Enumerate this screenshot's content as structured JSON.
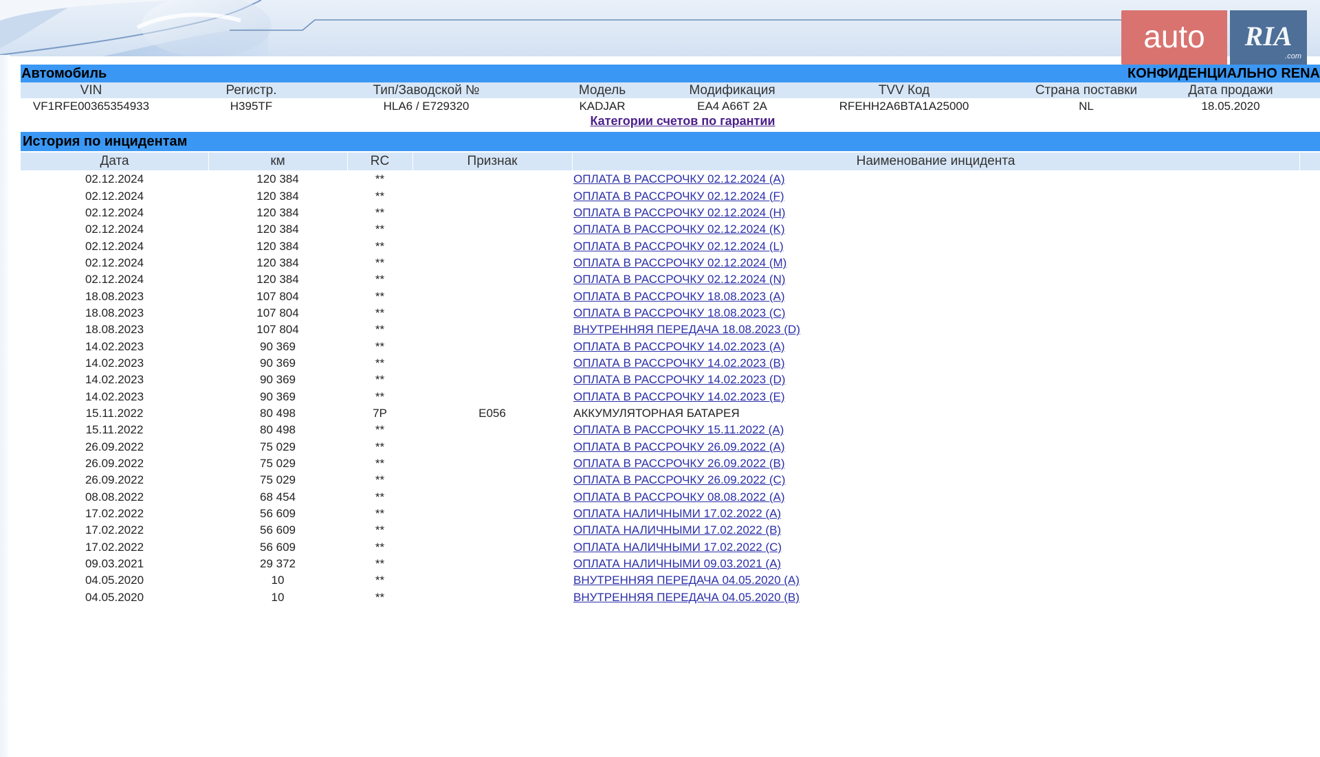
{
  "branding": {
    "logo_auto": "auto",
    "logo_ria": "RIA",
    "logo_com": ".com"
  },
  "vehicle": {
    "section_title": "Автомобиль",
    "confidential": "КОНФИДЕНЦИАЛЬНО RENA",
    "headers": [
      "VIN",
      "Регистр.",
      "Тип/Заводской №",
      "Модель",
      "Модификация",
      "TVV Код",
      "Страна поставки",
      "Дата продажи"
    ],
    "values": [
      "VF1RFE00365354933",
      "H395TF",
      "HLA6 / E729320",
      "KADJAR",
      "EA4 A66T 2A",
      "RFEHH2A6BTA1A25000",
      "NL",
      "18.05.2020"
    ],
    "warranty_link": "Категории счетов по гарантии"
  },
  "incidents": {
    "section_title": "История по инцидентам",
    "headers": [
      "Дата",
      "км",
      "RC",
      "Признак",
      "Наименование инцидента"
    ],
    "rows": [
      {
        "date": "02.12.2024",
        "km": "120 384",
        "rc": "**",
        "sign": "",
        "name": "ОПЛАТА В РАССРОЧКУ 02.12.2024 (A)",
        "link": true
      },
      {
        "date": "02.12.2024",
        "km": "120 384",
        "rc": "**",
        "sign": "",
        "name": "ОПЛАТА В РАССРОЧКУ 02.12.2024 (F)",
        "link": true
      },
      {
        "date": "02.12.2024",
        "km": "120 384",
        "rc": "**",
        "sign": "",
        "name": "ОПЛАТА В РАССРОЧКУ 02.12.2024 (H)",
        "link": true
      },
      {
        "date": "02.12.2024",
        "km": "120 384",
        "rc": "**",
        "sign": "",
        "name": "ОПЛАТА В РАССРОЧКУ 02.12.2024 (K)",
        "link": true
      },
      {
        "date": "02.12.2024",
        "km": "120 384",
        "rc": "**",
        "sign": "",
        "name": "ОПЛАТА В РАССРОЧКУ 02.12.2024 (L)",
        "link": true
      },
      {
        "date": "02.12.2024",
        "km": "120 384",
        "rc": "**",
        "sign": "",
        "name": "ОПЛАТА В РАССРОЧКУ 02.12.2024 (M)",
        "link": true
      },
      {
        "date": "02.12.2024",
        "km": "120 384",
        "rc": "**",
        "sign": "",
        "name": "ОПЛАТА В РАССРОЧКУ 02.12.2024 (N)",
        "link": true
      },
      {
        "date": "18.08.2023",
        "km": "107 804",
        "rc": "**",
        "sign": "",
        "name": "ОПЛАТА В РАССРОЧКУ 18.08.2023 (A)",
        "link": true
      },
      {
        "date": "18.08.2023",
        "km": "107 804",
        "rc": "**",
        "sign": "",
        "name": "ОПЛАТА В РАССРОЧКУ 18.08.2023 (C)",
        "link": true
      },
      {
        "date": "18.08.2023",
        "km": "107 804",
        "rc": "**",
        "sign": "",
        "name": "ВНУТРЕННЯЯ ПЕРЕДАЧА 18.08.2023 (D)",
        "link": true
      },
      {
        "date": "14.02.2023",
        "km": "90 369",
        "rc": "**",
        "sign": "",
        "name": "ОПЛАТА В РАССРОЧКУ 14.02.2023 (A)",
        "link": true
      },
      {
        "date": "14.02.2023",
        "km": "90 369",
        "rc": "**",
        "sign": "",
        "name": "ОПЛАТА В РАССРОЧКУ 14.02.2023 (B)",
        "link": true
      },
      {
        "date": "14.02.2023",
        "km": "90 369",
        "rc": "**",
        "sign": "",
        "name": "ОПЛАТА В РАССРОЧКУ 14.02.2023 (D)",
        "link": true
      },
      {
        "date": "14.02.2023",
        "km": "90 369",
        "rc": "**",
        "sign": "",
        "name": "ОПЛАТА В РАССРОЧКУ 14.02.2023 (E)",
        "link": true
      },
      {
        "date": "15.11.2022",
        "km": "80 498",
        "rc": "7P",
        "sign": "E056",
        "name": "АККУМУЛЯТОРНАЯ БАТАРЕЯ",
        "link": false
      },
      {
        "date": "15.11.2022",
        "km": "80 498",
        "rc": "**",
        "sign": "",
        "name": "ОПЛАТА В РАССРОЧКУ 15.11.2022 (A)",
        "link": true
      },
      {
        "date": "26.09.2022",
        "km": "75 029",
        "rc": "**",
        "sign": "",
        "name": "ОПЛАТА В РАССРОЧКУ 26.09.2022 (A)",
        "link": true
      },
      {
        "date": "26.09.2022",
        "km": "75 029",
        "rc": "**",
        "sign": "",
        "name": "ОПЛАТА В РАССРОЧКУ 26.09.2022 (B)",
        "link": true
      },
      {
        "date": "26.09.2022",
        "km": "75 029",
        "rc": "**",
        "sign": "",
        "name": "ОПЛАТА В РАССРОЧКУ 26.09.2022 (C)",
        "link": true
      },
      {
        "date": "08.08.2022",
        "km": "68 454",
        "rc": "**",
        "sign": "",
        "name": "ОПЛАТА В РАССРОЧКУ 08.08.2022 (A)",
        "link": true
      },
      {
        "date": "17.02.2022",
        "km": "56 609",
        "rc": "**",
        "sign": "",
        "name": "ОПЛАТА НАЛИЧНЫМИ 17.02.2022 (A)",
        "link": true
      },
      {
        "date": "17.02.2022",
        "km": "56 609",
        "rc": "**",
        "sign": "",
        "name": "ОПЛАТА НАЛИЧНЫМИ 17.02.2022 (B)",
        "link": true
      },
      {
        "date": "17.02.2022",
        "km": "56 609",
        "rc": "**",
        "sign": "",
        "name": "ОПЛАТА НАЛИЧНЫМИ 17.02.2022 (C)",
        "link": true
      },
      {
        "date": "09.03.2021",
        "km": "29 372",
        "rc": "**",
        "sign": "",
        "name": "ОПЛАТА НАЛИЧНЫМИ 09.03.2021 (A)",
        "link": true
      },
      {
        "date": "04.05.2020",
        "km": "10",
        "rc": "**",
        "sign": "",
        "name": "ВНУТРЕННЯЯ ПЕРЕДАЧА 04.05.2020 (A)",
        "link": true
      },
      {
        "date": "04.05.2020",
        "km": "10",
        "rc": "**",
        "sign": "",
        "name": "ВНУТРЕННЯЯ ПЕРЕДАЧА 04.05.2020 (B)",
        "link": true
      }
    ]
  },
  "colors": {
    "section_bar": "#3a97f3",
    "header_row": "#d6e6f7",
    "link": "#2b2fa8",
    "warranty_link": "#4b1f8a",
    "logo_auto_bg": "#d9736f",
    "logo_ria_bg": "#4d6f98"
  }
}
